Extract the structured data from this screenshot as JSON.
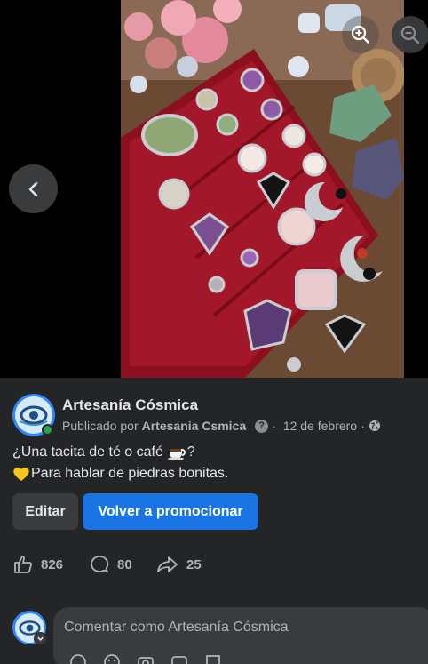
{
  "viewer": {
    "prev_icon": "chevron-left-icon",
    "zoom_in_icon": "zoom-in-icon",
    "zoom_out_icon": "zoom-out-icon"
  },
  "post": {
    "page_name": "Artesanía Cósmica",
    "published_by_prefix": "Publicado por",
    "published_by_name": "Artesania Csmica",
    "help_glyph": "?",
    "separator": "·",
    "date": "12 de febrero",
    "audience_icon": "globe-icon",
    "caption_line1": "¿Una tacita de té o café",
    "caption_line1_end": "?",
    "caption_line2": "Para hablar de piedras bonitas."
  },
  "actions": {
    "edit_label": "Editar",
    "promote_label": "Volver a promocionar"
  },
  "stats": {
    "likes": "826",
    "comments": "80",
    "shares": "25"
  },
  "comment": {
    "placeholder": "Comentar como Artesanía Cósmica"
  },
  "colors": {
    "background": "#18191a",
    "card": "#242526",
    "primary": "#1b74e4",
    "secondary_button": "#3a3b3c",
    "online": "#31a24c"
  }
}
